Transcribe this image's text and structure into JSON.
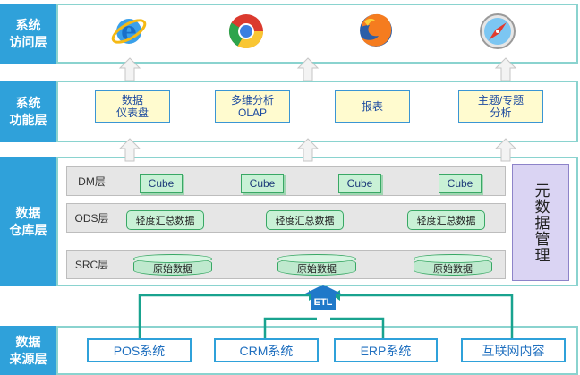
{
  "layers": {
    "access": "系统\n访问层",
    "function": "系统\n功能层",
    "warehouse": "数据\n仓库层",
    "source": "数据\n来源层"
  },
  "function_items": [
    "数据\n仪表盘",
    "多维分析\nOLAP",
    "报表",
    "主题/专题\n分析"
  ],
  "warehouse": {
    "rows": [
      "DM层",
      "ODS层",
      "SRC层"
    ],
    "cube_label": "Cube",
    "ods_label": "轻度汇总数据",
    "src_label": "原始数据",
    "metadata": "元数据管理"
  },
  "etl": "ETL",
  "sources": [
    "POS系统",
    "CRM系统",
    "ERP系统",
    "互联网内容"
  ],
  "browser_icons": [
    "internet-explorer-icon",
    "chrome-icon",
    "firefox-icon",
    "safari-icon"
  ],
  "colors": {
    "label_bg": "#2fa1da",
    "frame": "#8ad3cf",
    "arrow": "#19a38f",
    "doc_bg": "#fffbcf"
  }
}
